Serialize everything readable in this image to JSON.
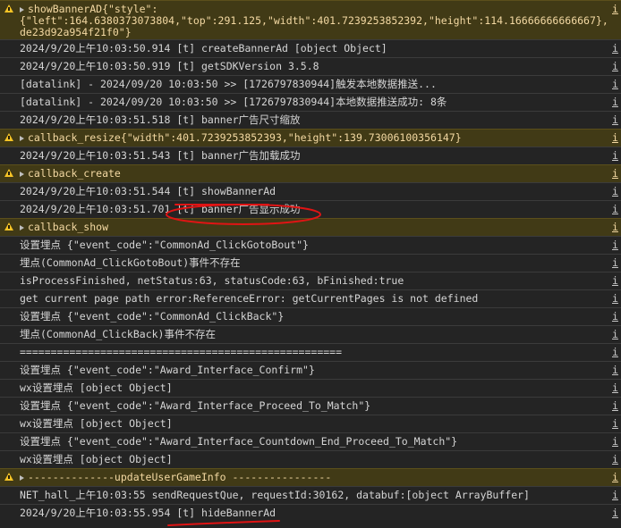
{
  "console": {
    "first_warning": {
      "line1": "showBannerAD{\"style\":",
      "line2": "{\"left\":164.6380373073804,\"top\":291.125,\"width\":401.7239253852392,\"height\":114.16666666666667},\"adUnitId\":\"adunit-",
      "line3": "de23d92a954f21f0\"}",
      "source": "i"
    },
    "rows": [
      {
        "type": "log",
        "text": "2024/9/20上午10:03:50.914  [t] createBannerAd [object Object]",
        "source": "i"
      },
      {
        "type": "log",
        "text": "2024/9/20上午10:03:50.919  [t] getSDKVersion 3.5.8",
        "source": "i"
      },
      {
        "type": "log",
        "text": "[datalink] - 2024/09/20 10:03:50 >> [1726797830944]触发本地数据推送...",
        "source": "i"
      },
      {
        "type": "log",
        "text": "[datalink] - 2024/09/20 10:03:50 >> [1726797830944]本地数据推送成功: 8条",
        "source": "i"
      },
      {
        "type": "log",
        "text": "2024/9/20上午10:03:51.518  [t] banner广告尺寸缩放",
        "source": "i"
      },
      {
        "type": "warn",
        "text": "callback_resize{\"width\":401.7239253852393,\"height\":139.73006100356147}",
        "source": "i"
      },
      {
        "type": "log",
        "text": "2024/9/20上午10:03:51.543  [t] banner广告加载成功",
        "source": "i"
      },
      {
        "type": "warn",
        "text": "callback_create",
        "source": "i"
      },
      {
        "type": "log",
        "text": "2024/9/20上午10:03:51.544  [t] showBannerAd",
        "source": "i"
      },
      {
        "type": "log",
        "text": "2024/9/20上午10:03:51.701  [t] banner广告显示成功",
        "source": "i"
      },
      {
        "type": "warn",
        "text": "callback_show",
        "source": "i"
      },
      {
        "type": "log",
        "text": "设置埋点 {\"event_code\":\"CommonAd_ClickGotoBout\"}",
        "source": "i"
      },
      {
        "type": "log",
        "text": "埋点(CommonAd_ClickGotoBout)事件不存在",
        "source": "i"
      },
      {
        "type": "log",
        "text": "isProcessFinished, netStatus:63, statusCode:63, bFinished:true",
        "source": "i"
      },
      {
        "type": "log",
        "text": "get current page path error:ReferenceError: getCurrentPages is not defined",
        "source": "i"
      },
      {
        "type": "log",
        "text": "设置埋点 {\"event_code\":\"CommonAd_ClickBack\"}",
        "source": "i"
      },
      {
        "type": "log",
        "text": "埋点(CommonAd_ClickBack)事件不存在",
        "source": "i"
      },
      {
        "type": "log",
        "text": "====================================================",
        "source": "i"
      },
      {
        "type": "log",
        "text": "设置埋点 {\"event_code\":\"Award_Interface_Confirm\"}",
        "source": "i"
      },
      {
        "type": "log",
        "text": "wx设置埋点 [object Object]",
        "source": "i"
      },
      {
        "type": "log",
        "text": "设置埋点 {\"event_code\":\"Award_Interface_Proceed_To_Match\"}",
        "source": "i"
      },
      {
        "type": "log",
        "text": "wx设置埋点 [object Object]",
        "source": "i"
      },
      {
        "type": "log",
        "text": "设置埋点 {\"event_code\":\"Award_Interface_Countdown_End_Proceed_To_Match\"}",
        "source": "i"
      },
      {
        "type": "log",
        "text": "wx设置埋点 [object Object]",
        "source": "i"
      },
      {
        "type": "warn",
        "text": "--------------updateUserGameInfo ----------------",
        "source": "i"
      },
      {
        "type": "log",
        "text": "NET_hall_上午10:03:55 sendRequestQue, requestId:30162, databuf:[object ArrayBuffer]",
        "source": "i"
      },
      {
        "type": "log",
        "text": "2024/9/20上午10:03:55.954  [t] hideBannerAd",
        "source": "i"
      }
    ]
  },
  "annotations": {
    "color": "#e01414",
    "underline_show_banner": "showBannerAd",
    "ellipse_show_success": "[t] banner广告显示成功",
    "underline_hide_banner": "[t] hideBannerAd"
  }
}
